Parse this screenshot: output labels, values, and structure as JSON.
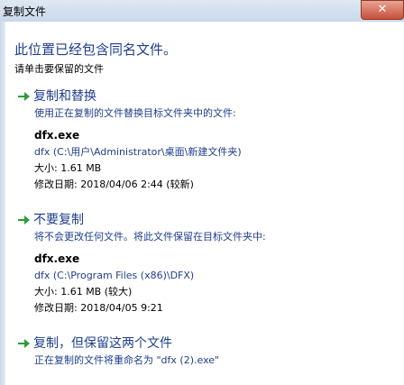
{
  "window": {
    "title": "复制文件",
    "close_glyph": "✕"
  },
  "header": {
    "headline": "此位置已经包含同名文件。",
    "subhead": "请单击要保留的文件"
  },
  "options": [
    {
      "title": "复制和替换",
      "desc": "使用正在复制的文件替换目标文件夹中的文件:",
      "file": {
        "name": "dfx.exe",
        "path": "dfx (C:\\用户\\Administrator\\桌面\\新建文件夹)",
        "size": "大小: 1.61 MB",
        "date": "修改日期: 2018/04/06  2:44 (较新)"
      }
    },
    {
      "title": "不要复制",
      "desc": "将不会更改任何文件。将此文件保留在目标文件夹中:",
      "file": {
        "name": "dfx.exe",
        "path": "dfx (C:\\Program Files (x86)\\DFX)",
        "size": "大小: 1.61 MB (较大)",
        "date": "修改日期: 2018/04/05  9:21"
      }
    },
    {
      "title": "复制，但保留这两个文件",
      "desc": "正在复制的文件将重命名为 \"dfx (2).exe\""
    }
  ],
  "colors": {
    "link_blue": "#1e3e8c",
    "arrow_green": "#2e9d3a"
  }
}
